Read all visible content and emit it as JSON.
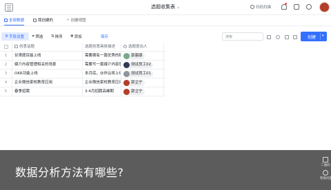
{
  "header": {
    "title": "选题收集表",
    "scan_label": "扫码扫描"
  },
  "views": {
    "tabs": [
      {
        "label": "全部数据",
        "active": true
      },
      {
        "label": "我创建的",
        "active": false
      }
    ],
    "create_view_label": "创建视图"
  },
  "toolbar": {
    "field_settings": "字段设置",
    "filter": "筛选",
    "sort": "排序",
    "add": "添加",
    "save": "保存",
    "search_placeholder": "搜索",
    "create_button": "创建"
  },
  "table": {
    "columns": [
      "创意话题",
      "选题创意具体描述",
      "选题提出人"
    ],
    "rows": [
      {
        "index": "1",
        "topic": "甘肃题目能上线",
        "description": "需要拥有一篇优秀的稿件",
        "person": "郭康康",
        "avatar_color": "#7aa88c"
      },
      {
        "index": "2",
        "topic": "媒介内容管理相关的场景",
        "description": "需要写一篇媒介内容管理",
        "person": "测试员工02",
        "avatar_color": "#2f3b55"
      },
      {
        "index": "3",
        "topic": "OKR功能上线",
        "description": "本月底，伙伴云将上线OKR",
        "person": "测试员工01",
        "avatar_color": "#8f959e"
      },
      {
        "index": "4",
        "topic": "企业微信家校教育应用",
        "description": "企业微信家校教育应用",
        "person": "郭立宁",
        "avatar_color": "#b33e2a"
      },
      {
        "index": "5",
        "topic": "春季招聘",
        "description": "3-4月招聘高峰期",
        "person": "郭立宁",
        "avatar_color": "#b33e2a"
      }
    ]
  },
  "overlay": {
    "question": "数据分析方法有哪些?"
  },
  "side_panel": {
    "labels": [
      "二维码",
      "帮助问题"
    ]
  },
  "colors": {
    "accent": "#3370ff",
    "overlay": "#4e4e4e"
  }
}
